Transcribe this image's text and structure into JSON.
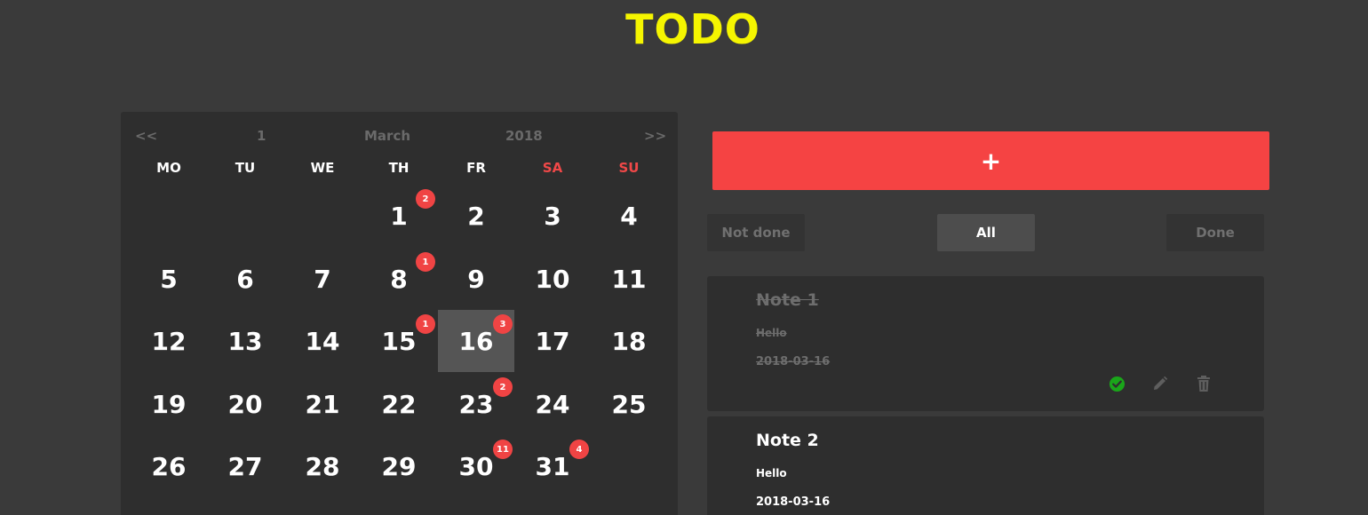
{
  "app": {
    "title": "TODO"
  },
  "calendar": {
    "nav": {
      "prev": "<<",
      "day": "1",
      "month": "March",
      "year": "2018",
      "next": ">>"
    },
    "weekdays": [
      "MO",
      "TU",
      "WE",
      "TH",
      "FR",
      "SA",
      "SU"
    ],
    "first_weekday_index": 3,
    "days_in_month": 31,
    "selected_day": 16,
    "day_labels": [
      "1",
      "2",
      "3",
      "4",
      "5",
      "6",
      "7",
      "8",
      "9",
      "10",
      "11",
      "12",
      "13",
      "14",
      "15",
      "16",
      "17",
      "18",
      "19",
      "20",
      "21",
      "22",
      "23",
      "24",
      "25",
      "26",
      "27",
      "28",
      "29",
      "30",
      "31"
    ],
    "badges": {
      "1": "2",
      "8": "1",
      "15": "1",
      "16": "3",
      "23": "2",
      "30": "11",
      "31": "4"
    }
  },
  "todo": {
    "add_label": "+",
    "filters": {
      "not_done": "Not done",
      "all": "All",
      "done": "Done"
    },
    "active_filter": "all",
    "notes": [
      {
        "title": "Note 1",
        "body": "Hello",
        "date": "2018-03-16",
        "done": true
      },
      {
        "title": "Note 2",
        "body": "Hello",
        "date": "2018-03-16",
        "done": false
      }
    ]
  },
  "colors": {
    "accent_red": "#f54343",
    "title_yellow": "#f5f500",
    "done_green": "#1aa51a",
    "weekend_red": "#f04848"
  }
}
